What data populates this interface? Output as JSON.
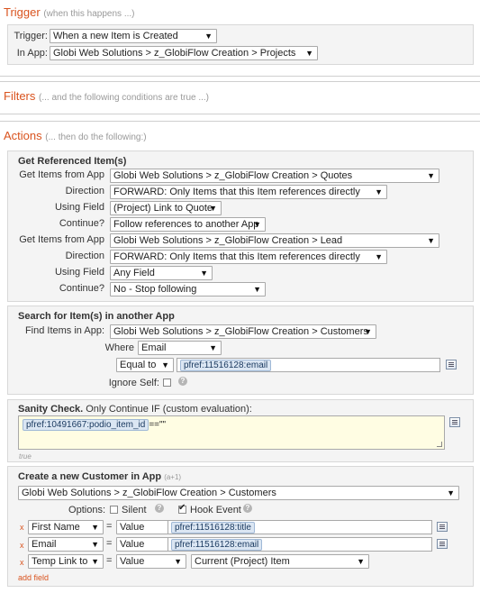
{
  "trigger": {
    "title": "Trigger",
    "hint": "(when this happens ...)",
    "trigger_label": "Trigger:",
    "trigger_value": "When a new Item is Created",
    "app_label": "In App:",
    "app_value": "Globi Web Solutions > z_GlobiFlow Creation > Projects"
  },
  "filters": {
    "title": "Filters",
    "hint": "(... and the following conditions are true ...)"
  },
  "actions": {
    "title": "Actions",
    "hint": "(... then do the following:)"
  },
  "get_ref": {
    "heading": "Get Referenced Item(s)",
    "labels": {
      "get_items": "Get Items from App",
      "direction": "Direction",
      "using_field": "Using Field",
      "continue": "Continue?"
    },
    "block1": {
      "app": "Globi Web Solutions > z_GlobiFlow Creation > Quotes",
      "direction": "FORWARD: Only Items that this Item references directly",
      "field": "(Project) Link to Quote",
      "continue": "Follow references to another App"
    },
    "block2": {
      "app": "Globi Web Solutions > z_GlobiFlow Creation > Lead",
      "direction": "FORWARD: Only Items that this Item references directly",
      "field": "Any Field",
      "continue": "No - Stop following"
    }
  },
  "search": {
    "heading": "Search for Item(s) in another App",
    "find_label": "Find Items in App:",
    "find_value": "Globi Web Solutions > z_GlobiFlow Creation > Customers",
    "where_label": "Where",
    "where_value": "Email",
    "op_value": "Equal to",
    "token": "pfref:11516128:email",
    "ignore_label": "Ignore Self:"
  },
  "sanity": {
    "heading": "Sanity Check.",
    "sub": "Only Continue IF (custom evaluation):",
    "token": "pfref:10491667:podio_item_id",
    "expr_suffix": "==\"\"",
    "note": "true"
  },
  "create": {
    "heading": "Create a new Customer in App",
    "tiny": "(a+1)",
    "app_value": "Globi Web Solutions > z_GlobiFlow Creation > Customers",
    "options_label": "Options:",
    "silent_label": "Silent",
    "hook_label": "Hook Event",
    "rows": [
      {
        "field": "First Name",
        "eq": "=",
        "type": "Value",
        "token": "pfref:11516128:title"
      },
      {
        "field": "Email",
        "eq": "=",
        "type": "Value",
        "token": "pfref:11516128:email"
      },
      {
        "field": "Temp Link to",
        "eq": "=",
        "type": "Value",
        "value": "Current (Project) Item"
      }
    ],
    "x": "x",
    "add_field": "add field"
  },
  "icons": {
    "arrow": "▼",
    "help": "?"
  }
}
